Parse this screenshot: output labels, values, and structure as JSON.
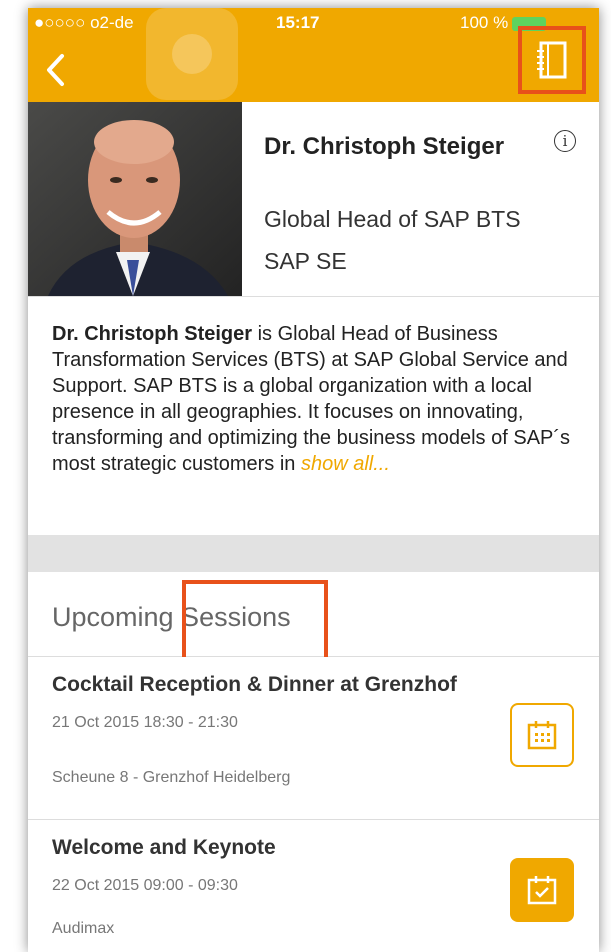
{
  "status_bar": {
    "carrier": "●○○○○ o2-de",
    "time": "15:17",
    "battery": "100 %"
  },
  "speaker": {
    "name": "Dr. Christoph Steiger",
    "title": "Global Head of SAP BTS",
    "company": "SAP SE"
  },
  "bio": {
    "name_bold": "Dr. Christoph Steiger",
    "text": " is Global Head of Business Transformation Services (BTS) at SAP Global Service and Support. SAP BTS is a global organization with a local presence in all geographies. It focuses on innovating, transforming and optimizing the business models of SAP´s most strategic customers in ",
    "show_all": "show all..."
  },
  "sessions": {
    "heading": "Upcoming Sessions",
    "items": [
      {
        "title": "Cocktail Reception & Dinner at Grenzhof",
        "time": "21 Oct 2015 18:30 - 21:30",
        "location": "Scheune 8 - Grenzhof Heidelberg",
        "calendar_state": "add"
      },
      {
        "title": "Welcome and Keynote",
        "time": "22 Oct 2015 09:00 - 09:30",
        "location": "Audimax",
        "calendar_state": "added"
      }
    ]
  },
  "colors": {
    "accent": "#f0a800",
    "highlight": "#e8511a"
  }
}
